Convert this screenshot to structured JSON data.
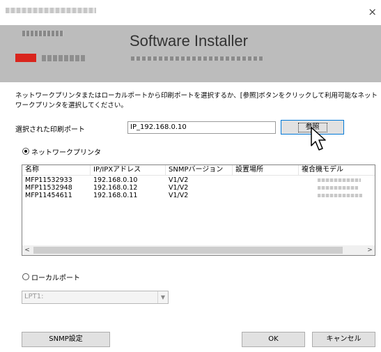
{
  "window": {
    "close_glyph": "×"
  },
  "header": {
    "title": "Software Installer"
  },
  "instructions": "ネットワークプリンタまたはローカルポートから印刷ポートを選択するか、[参照]ボタンをクリックして利用可能なネットワークプリンタを選択してください。",
  "port": {
    "label": "選択された印刷ポート",
    "value": "IP_192.168.0.10",
    "browse_label": "参照"
  },
  "network": {
    "radio_label": "ネットワークプリンタ",
    "columns": [
      "名称",
      "IP/IPXアドレス",
      "SNMPバージョン",
      "設置場所",
      "複合機モデル"
    ],
    "rows": [
      {
        "name": "MFP11532933",
        "ip": "192.168.0.10",
        "snmp": "V1/V2",
        "location": ""
      },
      {
        "name": "MFP11532948",
        "ip": "192.168.0.12",
        "snmp": "V1/V2",
        "location": ""
      },
      {
        "name": "MFP11454611",
        "ip": "192.168.0.11",
        "snmp": "V1/V2",
        "location": ""
      }
    ],
    "scroll_left": "<",
    "scroll_right": ">"
  },
  "local": {
    "radio_label": "ローカルポート",
    "selected": "LPT1:",
    "arrow": "▼"
  },
  "buttons": {
    "snmp": "SNMP設定",
    "ok": "OK",
    "cancel": "キャンセル"
  },
  "icons": {
    "cursor": "mouse-pointer-icon"
  }
}
